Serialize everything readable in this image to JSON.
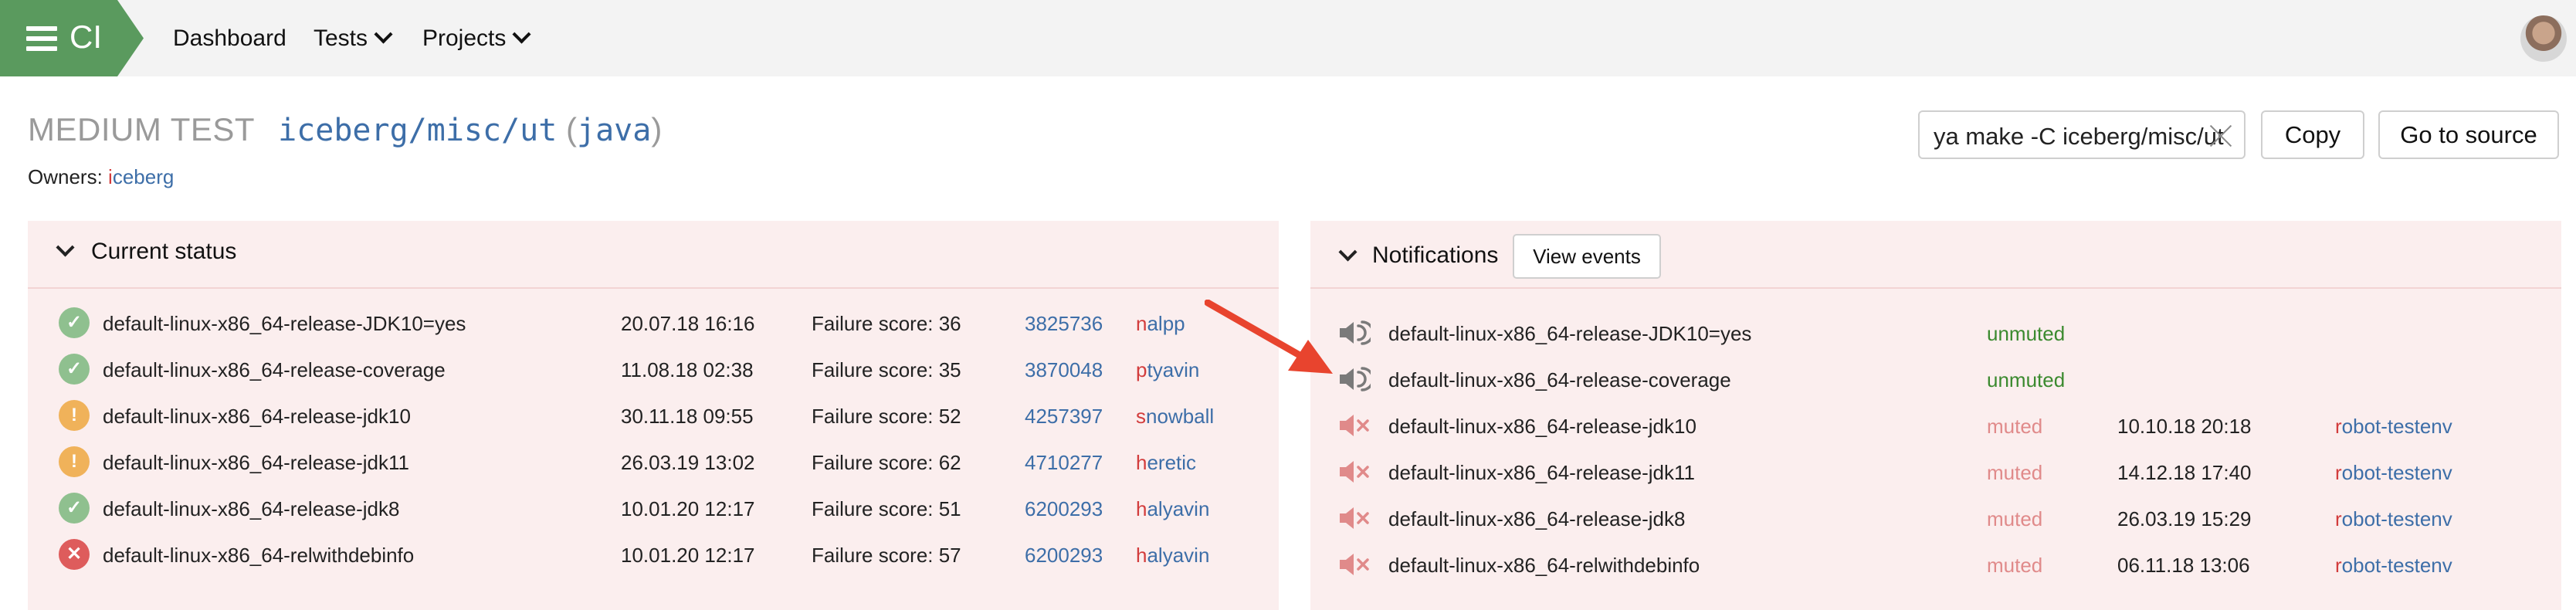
{
  "nav": {
    "logo_text": "CI",
    "items": [
      "Dashboard",
      "Tests",
      "Projects"
    ]
  },
  "header": {
    "test_kind": "MEDIUM TEST",
    "path": "iceberg/misc/ut",
    "paren_open": "(",
    "language": "java",
    "paren_close": ")",
    "owners_label": "Owners: ",
    "owner_first": "i",
    "owner_rest": "ceberg",
    "command_value": "ya make -C iceberg/misc/ut",
    "copy_label": "Copy",
    "source_label": "Go to source"
  },
  "status_panel": {
    "title": "Current status",
    "rows": [
      {
        "icon": "check-icon",
        "status": "ok",
        "toolchain": "default-linux-x86_64-release-JDK10=yes",
        "date": "20.07.18 16:16",
        "score": "Failure score: 36",
        "revision": "3825736",
        "author_first": "n",
        "author_rest": "alpp"
      },
      {
        "icon": "check-icon",
        "status": "ok",
        "toolchain": "default-linux-x86_64-release-coverage",
        "date": "11.08.18 02:38",
        "score": "Failure score: 35",
        "revision": "3870048",
        "author_first": "p",
        "author_rest": "tyavin"
      },
      {
        "icon": "warning-icon",
        "status": "warn",
        "toolchain": "default-linux-x86_64-release-jdk10",
        "date": "30.11.18 09:55",
        "score": "Failure score: 52",
        "revision": "4257397",
        "author_first": "s",
        "author_rest": "nowball"
      },
      {
        "icon": "warning-icon",
        "status": "warn",
        "toolchain": "default-linux-x86_64-release-jdk11",
        "date": "26.03.19 13:02",
        "score": "Failure score: 62",
        "revision": "4710277",
        "author_first": "h",
        "author_rest": "eretic"
      },
      {
        "icon": "check-icon",
        "status": "ok",
        "toolchain": "default-linux-x86_64-release-jdk8",
        "date": "10.01.20 12:17",
        "score": "Failure score: 51",
        "revision": "6200293",
        "author_first": "h",
        "author_rest": "alyavin"
      },
      {
        "icon": "error-icon",
        "status": "fail",
        "toolchain": "default-linux-x86_64-relwithdebinfo",
        "date": "10.01.20 12:17",
        "score": "Failure score: 57",
        "revision": "6200293",
        "author_first": "h",
        "author_rest": "alyavin"
      }
    ]
  },
  "notifications_panel": {
    "title": "Notifications",
    "view_events_label": "View events",
    "rows": [
      {
        "icon": "speaker-icon",
        "toolchain": "default-linux-x86_64-release-JDK10=yes",
        "state": "unmuted",
        "date": "",
        "user_first": "",
        "user_rest": ""
      },
      {
        "icon": "speaker-icon",
        "toolchain": "default-linux-x86_64-release-coverage",
        "state": "unmuted",
        "date": "",
        "user_first": "",
        "user_rest": ""
      },
      {
        "icon": "speaker-muted-icon",
        "toolchain": "default-linux-x86_64-release-jdk10",
        "state": "muted",
        "date": "10.10.18 20:18",
        "user_first": "r",
        "user_rest": "obot-testenv"
      },
      {
        "icon": "speaker-muted-icon",
        "toolchain": "default-linux-x86_64-release-jdk11",
        "state": "muted",
        "date": "14.12.18 17:40",
        "user_first": "r",
        "user_rest": "obot-testenv"
      },
      {
        "icon": "speaker-muted-icon",
        "toolchain": "default-linux-x86_64-release-jdk8",
        "state": "muted",
        "date": "26.03.19 15:29",
        "user_first": "r",
        "user_rest": "obot-testenv"
      },
      {
        "icon": "speaker-muted-icon",
        "toolchain": "default-linux-x86_64-relwithdebinfo",
        "state": "muted",
        "date": "06.11.18 13:06",
        "user_first": "r",
        "user_rest": "obot-testenv"
      }
    ]
  },
  "colors": {
    "logo_green": "#5a9a5e",
    "link_blue": "#3d6ea8",
    "author_red": "#d23c3c",
    "panel_bg": "#fbeeee",
    "annotation_arrow": "#e8442e"
  }
}
